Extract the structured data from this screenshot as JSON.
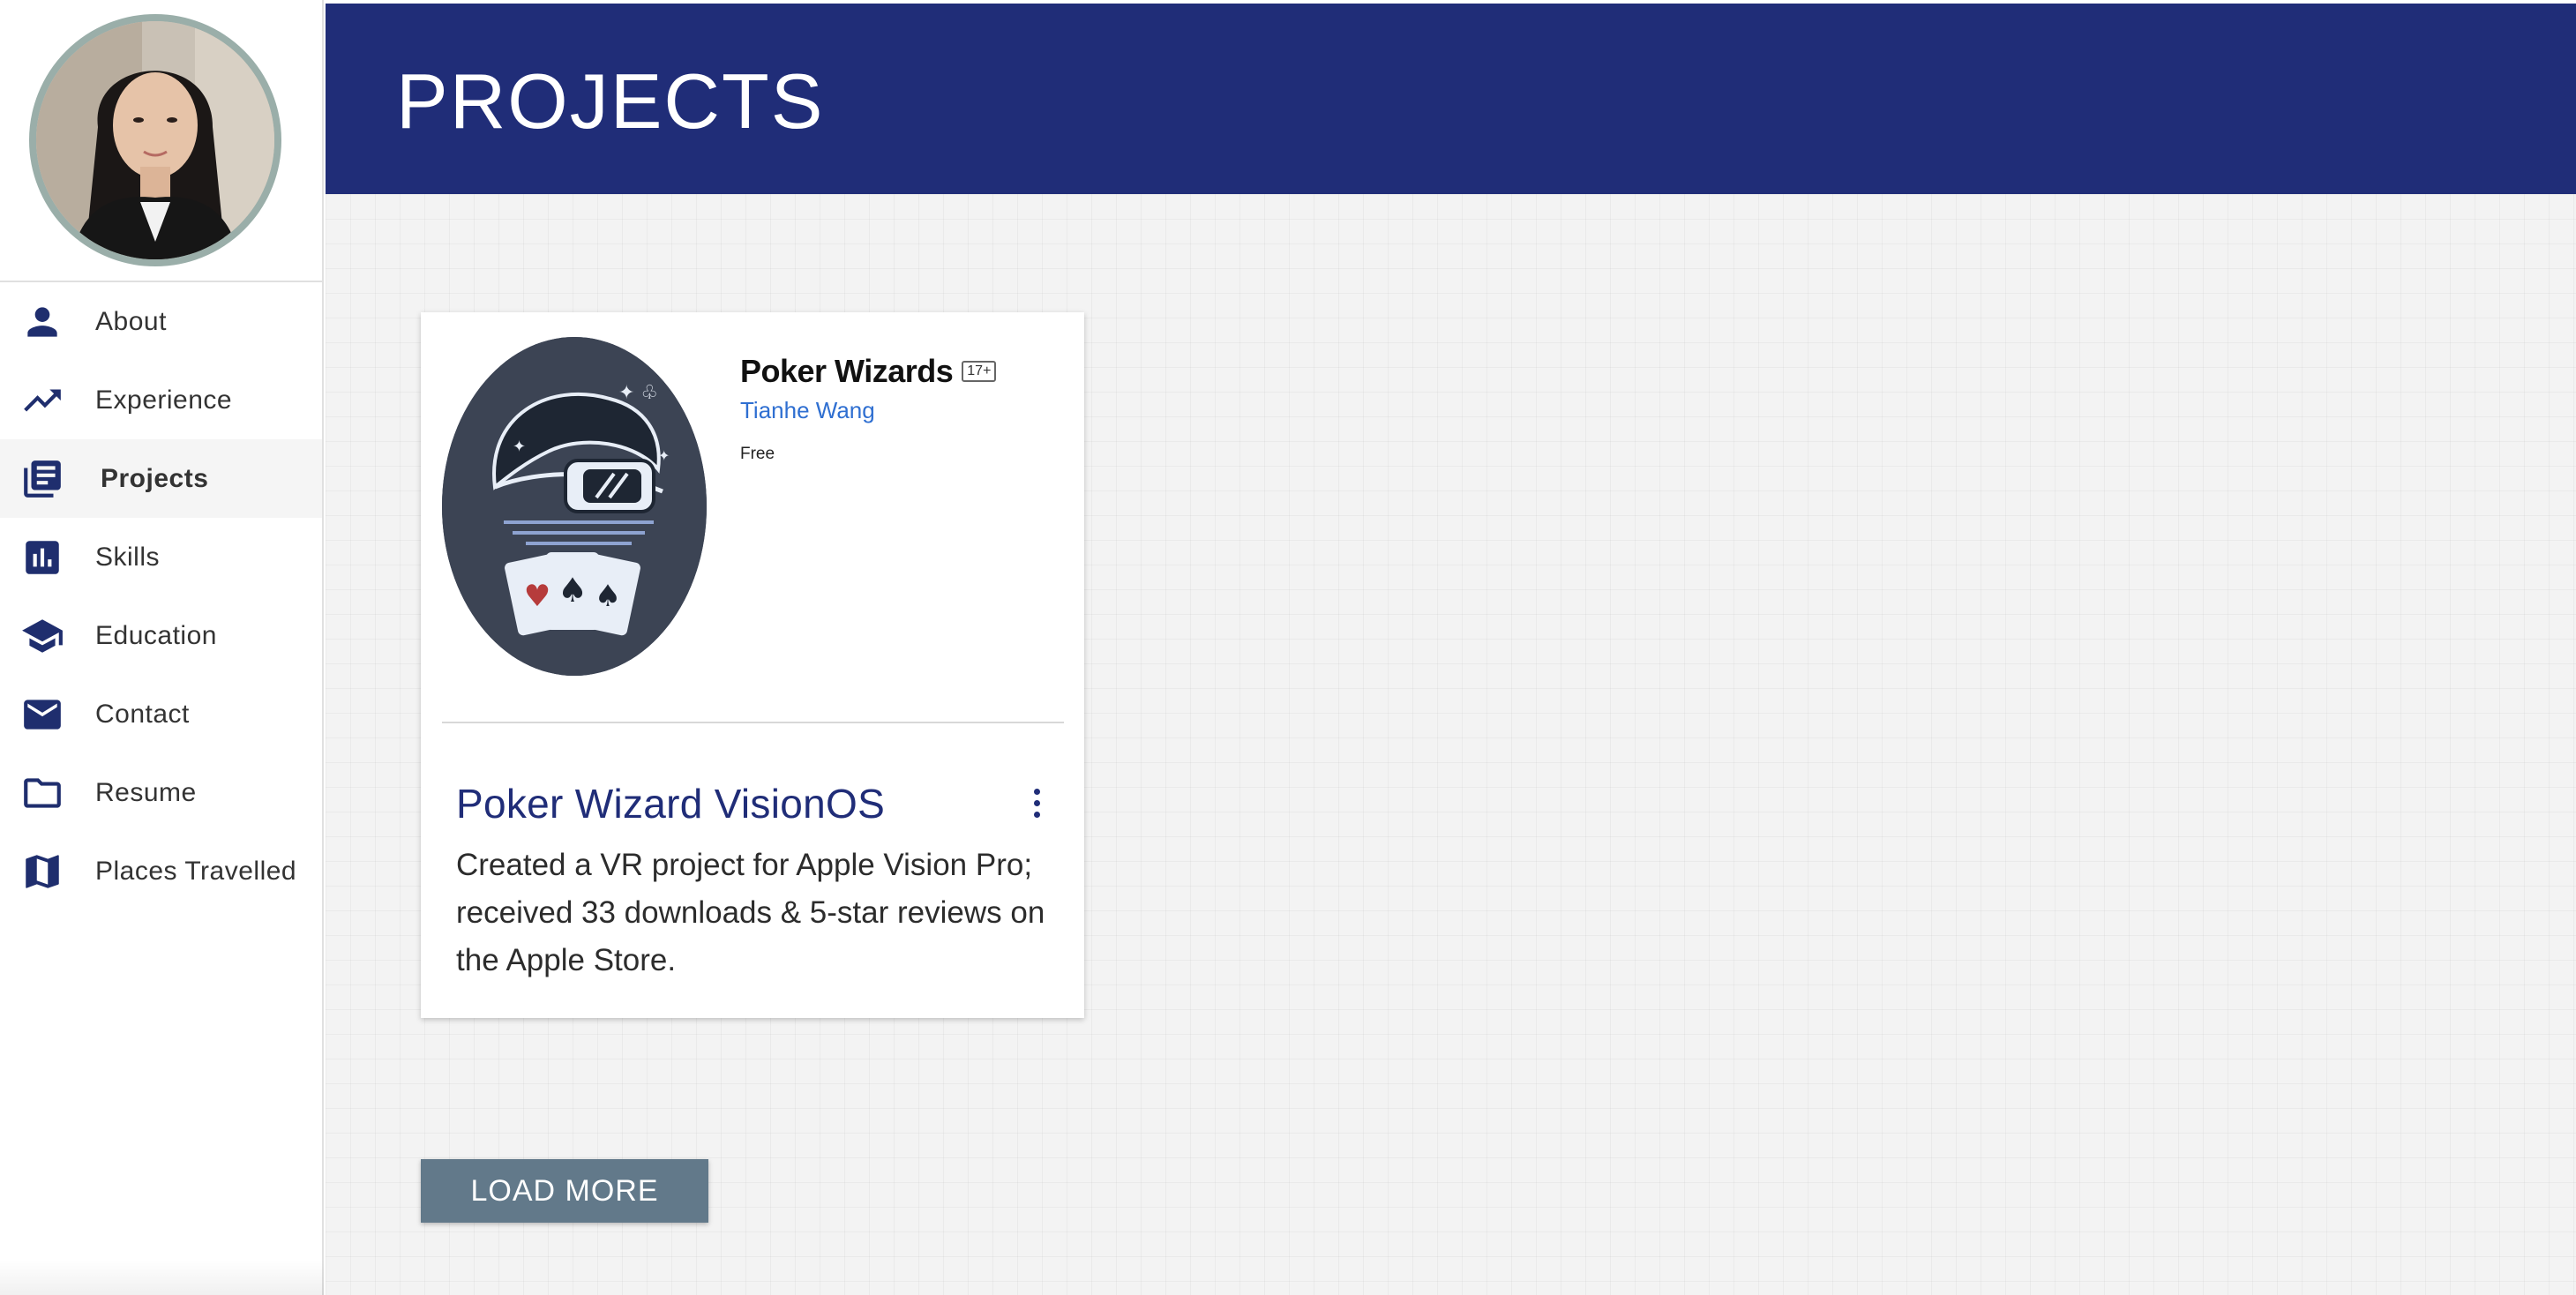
{
  "sidebar": {
    "items": [
      {
        "label": "About",
        "icon": "person-icon"
      },
      {
        "label": "Experience",
        "icon": "trending-up-icon"
      },
      {
        "label": "Projects",
        "icon": "library-books-icon",
        "active": true
      },
      {
        "label": "Skills",
        "icon": "bar-chart-icon"
      },
      {
        "label": "Education",
        "icon": "graduation-cap-icon"
      },
      {
        "label": "Contact",
        "icon": "mail-icon"
      },
      {
        "label": "Resume",
        "icon": "folder-icon"
      },
      {
        "label": "Places Travelled",
        "icon": "map-icon"
      }
    ]
  },
  "header": {
    "title": "PROJECTS"
  },
  "project": {
    "app_name": "Poker Wizards",
    "age_rating": "17+",
    "developer": "Tianhe Wang",
    "price": "Free",
    "title": "Poker Wizard VisionOS",
    "description": "Created a VR project for Apple Vision Pro; received 33 downloads & 5-star reviews on the Apple Store."
  },
  "actions": {
    "load_more": "LOAD MORE"
  },
  "colors": {
    "header_bg": "#202d78",
    "accent": "#202d78",
    "button_bg": "#62798a",
    "link": "#2f6fd1"
  }
}
